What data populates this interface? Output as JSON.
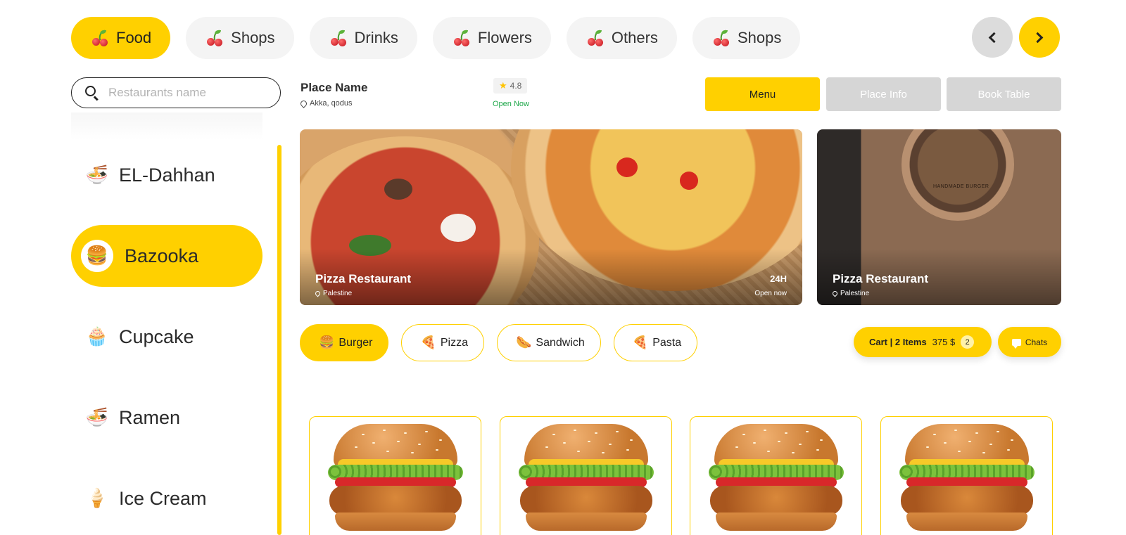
{
  "top_categories": [
    {
      "label": "Food",
      "active": true
    },
    {
      "label": "Shops",
      "active": false
    },
    {
      "label": "Drinks",
      "active": false
    },
    {
      "label": "Flowers",
      "active": false
    },
    {
      "label": "Others",
      "active": false
    },
    {
      "label": "Shops",
      "active": false
    }
  ],
  "search": {
    "placeholder": "Restaurants name"
  },
  "sidebar": {
    "items": [
      {
        "label": "EL-Dahhan",
        "icon": "ramen-icon",
        "glyph": "🍜",
        "active": false
      },
      {
        "label": "Bazooka",
        "icon": "burger-icon",
        "glyph": "🍔",
        "active": true
      },
      {
        "label": "Cupcake",
        "icon": "cupcake-icon",
        "glyph": "🧁",
        "active": false
      },
      {
        "label": "Ramen",
        "icon": "ramen-icon",
        "glyph": "🍜",
        "active": false
      },
      {
        "label": "Ice Cream",
        "icon": "ice-cream-icon",
        "glyph": "🍦",
        "active": false
      }
    ]
  },
  "place": {
    "name": "Place Name",
    "location": "Akka, qodus",
    "rating": "4.8",
    "status": "Open Now"
  },
  "tabs": {
    "menu": "Menu",
    "place_info": "Place Info",
    "book_table": "Book Table"
  },
  "banners": [
    {
      "title": "Pizza Restaurant",
      "location": "Palestine",
      "hours": "24H",
      "status": "Open now"
    },
    {
      "title": "Pizza Restaurant",
      "location": "Palestine",
      "sign_text": "HANDMADE BURGER"
    }
  ],
  "menu_categories": [
    {
      "label": "Burger",
      "glyph": "🍔",
      "active": true
    },
    {
      "label": "Pizza",
      "glyph": "🍕",
      "active": false
    },
    {
      "label": "Sandwich",
      "glyph": "🌭",
      "active": false
    },
    {
      "label": "Pasta",
      "glyph": "🍕",
      "active": false
    }
  ],
  "cart": {
    "label": "Cart | 2 Items",
    "total": "375 $",
    "count": "2"
  },
  "chats": {
    "label": "Chats"
  },
  "colors": {
    "accent": "#ffd000",
    "inactive": "#d6d6d6",
    "open_green": "#1fa84a"
  }
}
